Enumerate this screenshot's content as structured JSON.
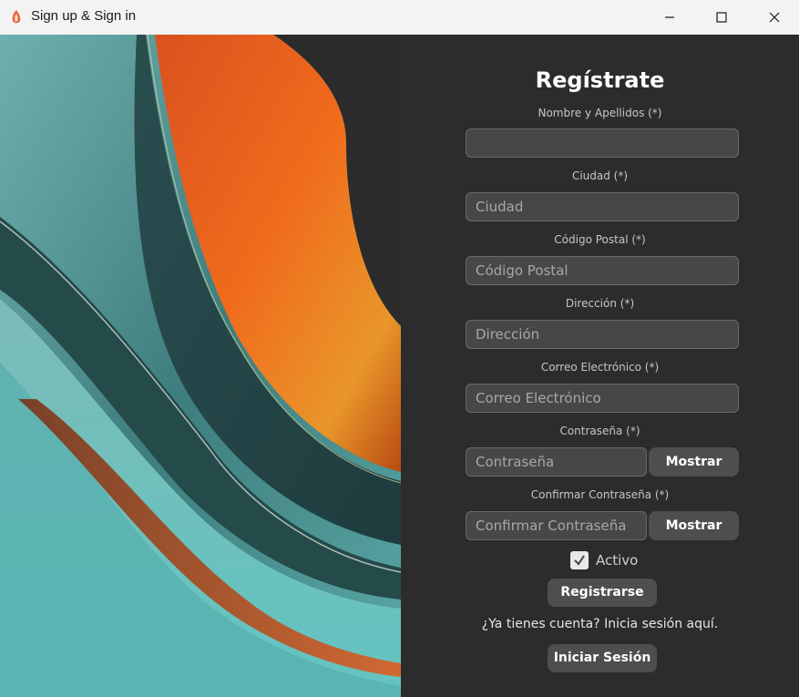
{
  "window": {
    "title": "Sign up & Sign in"
  },
  "form": {
    "heading": "Regístrate",
    "fields": [
      {
        "label": "Nombre y Apellidos (*)",
        "placeholder": ""
      },
      {
        "label": "Ciudad (*)",
        "placeholder": "Ciudad"
      },
      {
        "label": "Código Postal (*)",
        "placeholder": "Código Postal"
      },
      {
        "label": "Dirección (*)",
        "placeholder": "Dirección"
      },
      {
        "label": "Correo Electrónico (*)",
        "placeholder": "Correo Electrónico"
      },
      {
        "label": "Contraseña (*)",
        "placeholder": "Contraseña"
      },
      {
        "label": "Confirmar Contraseña (*)",
        "placeholder": "Confirmar Contraseña"
      }
    ],
    "show_label": "Mostrar",
    "active_label": "Activo",
    "active_checked": true,
    "register_label": "Registrarse",
    "login_prompt": "¿Ya tienes cuenta? Inicia sesión aquí.",
    "login_label": "Iniciar Sesión"
  }
}
